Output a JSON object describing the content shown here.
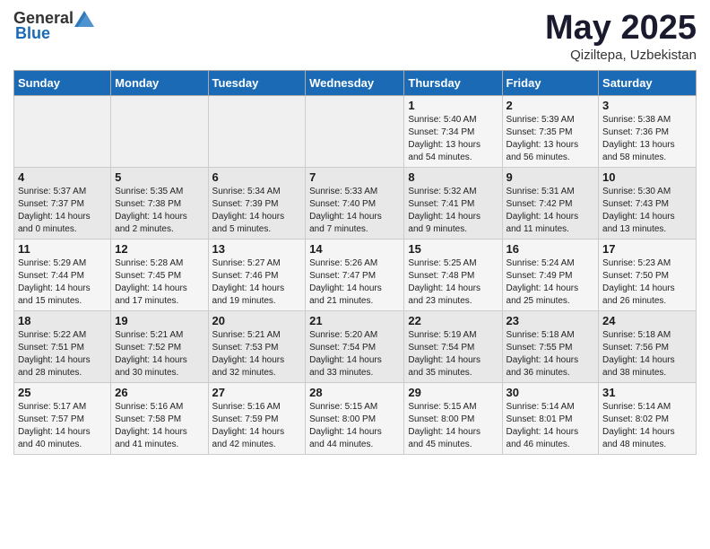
{
  "header": {
    "logo_general": "General",
    "logo_blue": "Blue",
    "month": "May 2025",
    "location": "Qiziltepa, Uzbekistan"
  },
  "days_of_week": [
    "Sunday",
    "Monday",
    "Tuesday",
    "Wednesday",
    "Thursday",
    "Friday",
    "Saturday"
  ],
  "weeks": [
    [
      {
        "day": "",
        "info": ""
      },
      {
        "day": "",
        "info": ""
      },
      {
        "day": "",
        "info": ""
      },
      {
        "day": "",
        "info": ""
      },
      {
        "day": "1",
        "info": "Sunrise: 5:40 AM\nSunset: 7:34 PM\nDaylight: 13 hours\nand 54 minutes."
      },
      {
        "day": "2",
        "info": "Sunrise: 5:39 AM\nSunset: 7:35 PM\nDaylight: 13 hours\nand 56 minutes."
      },
      {
        "day": "3",
        "info": "Sunrise: 5:38 AM\nSunset: 7:36 PM\nDaylight: 13 hours\nand 58 minutes."
      }
    ],
    [
      {
        "day": "4",
        "info": "Sunrise: 5:37 AM\nSunset: 7:37 PM\nDaylight: 14 hours\nand 0 minutes."
      },
      {
        "day": "5",
        "info": "Sunrise: 5:35 AM\nSunset: 7:38 PM\nDaylight: 14 hours\nand 2 minutes."
      },
      {
        "day": "6",
        "info": "Sunrise: 5:34 AM\nSunset: 7:39 PM\nDaylight: 14 hours\nand 5 minutes."
      },
      {
        "day": "7",
        "info": "Sunrise: 5:33 AM\nSunset: 7:40 PM\nDaylight: 14 hours\nand 7 minutes."
      },
      {
        "day": "8",
        "info": "Sunrise: 5:32 AM\nSunset: 7:41 PM\nDaylight: 14 hours\nand 9 minutes."
      },
      {
        "day": "9",
        "info": "Sunrise: 5:31 AM\nSunset: 7:42 PM\nDaylight: 14 hours\nand 11 minutes."
      },
      {
        "day": "10",
        "info": "Sunrise: 5:30 AM\nSunset: 7:43 PM\nDaylight: 14 hours\nand 13 minutes."
      }
    ],
    [
      {
        "day": "11",
        "info": "Sunrise: 5:29 AM\nSunset: 7:44 PM\nDaylight: 14 hours\nand 15 minutes."
      },
      {
        "day": "12",
        "info": "Sunrise: 5:28 AM\nSunset: 7:45 PM\nDaylight: 14 hours\nand 17 minutes."
      },
      {
        "day": "13",
        "info": "Sunrise: 5:27 AM\nSunset: 7:46 PM\nDaylight: 14 hours\nand 19 minutes."
      },
      {
        "day": "14",
        "info": "Sunrise: 5:26 AM\nSunset: 7:47 PM\nDaylight: 14 hours\nand 21 minutes."
      },
      {
        "day": "15",
        "info": "Sunrise: 5:25 AM\nSunset: 7:48 PM\nDaylight: 14 hours\nand 23 minutes."
      },
      {
        "day": "16",
        "info": "Sunrise: 5:24 AM\nSunset: 7:49 PM\nDaylight: 14 hours\nand 25 minutes."
      },
      {
        "day": "17",
        "info": "Sunrise: 5:23 AM\nSunset: 7:50 PM\nDaylight: 14 hours\nand 26 minutes."
      }
    ],
    [
      {
        "day": "18",
        "info": "Sunrise: 5:22 AM\nSunset: 7:51 PM\nDaylight: 14 hours\nand 28 minutes."
      },
      {
        "day": "19",
        "info": "Sunrise: 5:21 AM\nSunset: 7:52 PM\nDaylight: 14 hours\nand 30 minutes."
      },
      {
        "day": "20",
        "info": "Sunrise: 5:21 AM\nSunset: 7:53 PM\nDaylight: 14 hours\nand 32 minutes."
      },
      {
        "day": "21",
        "info": "Sunrise: 5:20 AM\nSunset: 7:54 PM\nDaylight: 14 hours\nand 33 minutes."
      },
      {
        "day": "22",
        "info": "Sunrise: 5:19 AM\nSunset: 7:54 PM\nDaylight: 14 hours\nand 35 minutes."
      },
      {
        "day": "23",
        "info": "Sunrise: 5:18 AM\nSunset: 7:55 PM\nDaylight: 14 hours\nand 36 minutes."
      },
      {
        "day": "24",
        "info": "Sunrise: 5:18 AM\nSunset: 7:56 PM\nDaylight: 14 hours\nand 38 minutes."
      }
    ],
    [
      {
        "day": "25",
        "info": "Sunrise: 5:17 AM\nSunset: 7:57 PM\nDaylight: 14 hours\nand 40 minutes."
      },
      {
        "day": "26",
        "info": "Sunrise: 5:16 AM\nSunset: 7:58 PM\nDaylight: 14 hours\nand 41 minutes."
      },
      {
        "day": "27",
        "info": "Sunrise: 5:16 AM\nSunset: 7:59 PM\nDaylight: 14 hours\nand 42 minutes."
      },
      {
        "day": "28",
        "info": "Sunrise: 5:15 AM\nSunset: 8:00 PM\nDaylight: 14 hours\nand 44 minutes."
      },
      {
        "day": "29",
        "info": "Sunrise: 5:15 AM\nSunset: 8:00 PM\nDaylight: 14 hours\nand 45 minutes."
      },
      {
        "day": "30",
        "info": "Sunrise: 5:14 AM\nSunset: 8:01 PM\nDaylight: 14 hours\nand 46 minutes."
      },
      {
        "day": "31",
        "info": "Sunrise: 5:14 AM\nSunset: 8:02 PM\nDaylight: 14 hours\nand 48 minutes."
      }
    ]
  ]
}
